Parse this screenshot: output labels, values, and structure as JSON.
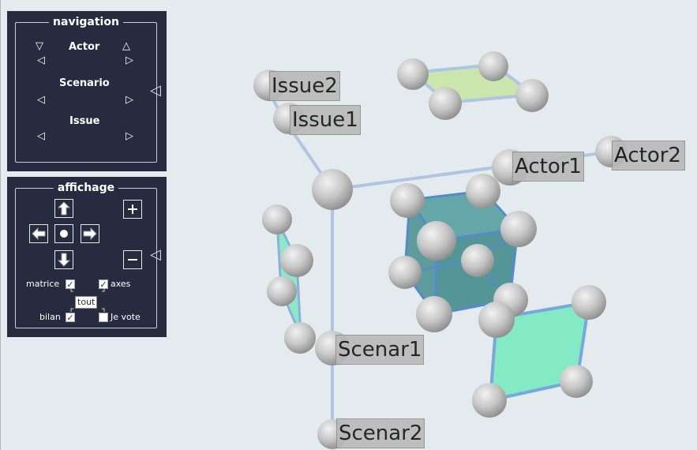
{
  "navigation": {
    "title": "navigation",
    "actor_label": "Actor",
    "scenario_label": "Scenario",
    "issue_label": "Issue"
  },
  "affichage": {
    "title": "affichage",
    "matrice_label": "matrice",
    "axes_label": "axes",
    "tout_label": "tout",
    "bilan_label": "bilan",
    "je_vote_label": "Je vote",
    "matrice_checked": true,
    "axes_checked": true,
    "bilan_checked": true,
    "je_vote_checked": false
  },
  "scene_labels": {
    "issue2": "Issue2",
    "issue1": "Issue1",
    "actor1": "Actor1",
    "actor2": "Actor2",
    "scenar1": "Scenar1",
    "scenar2": "Scenar2"
  },
  "colors": {
    "panel_bg": "#262b3f",
    "viewport_bg": "#e4ebef",
    "axis_line": "#a8c0e0",
    "sphere": "#c4c4c4",
    "teal_cube": "#3f8a8a",
    "green_quad": "#7ee8c2",
    "light_green_quad": "#c8e6a8"
  }
}
